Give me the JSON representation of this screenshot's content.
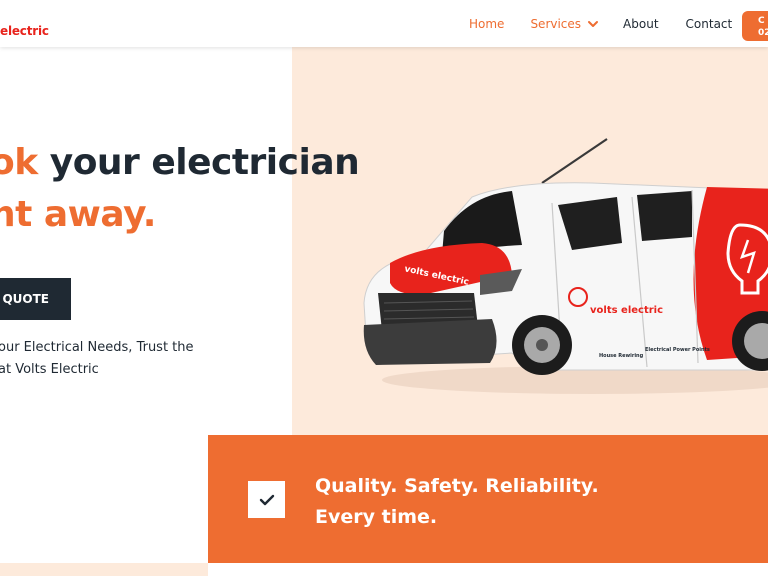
{
  "header": {
    "logo_text": "electric",
    "nav": {
      "home": "Home",
      "services": "Services",
      "about": "About",
      "contact": "Contact"
    },
    "cta_line1": "C",
    "cta_line2": "02"
  },
  "hero": {
    "title_line1_accent": "ok",
    "title_line1_rest": " your electrician",
    "title_line2_accent": "ht away.",
    "button_label": "A QUOTE",
    "subtitle_line1": "our Electrical Needs, Trust the",
    "subtitle_line2": "at Volts Electric"
  },
  "van": {
    "bonnet_text": "volts electric",
    "side_text": "volts electric",
    "service_1": "House Rewiring",
    "service_2": "Electrical Power Points"
  },
  "band": {
    "line1": "Quality. Safety. Reliability.",
    "line2": "Every time."
  },
  "colors": {
    "accent": "#ee6d31",
    "dark": "#1f2933",
    "peach": "#fdeadb",
    "brand_red": "#e8231c"
  }
}
